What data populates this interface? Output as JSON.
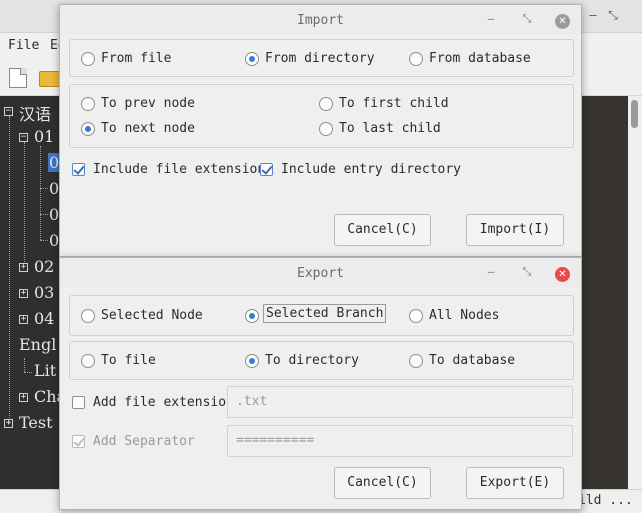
{
  "main": {
    "menu": {
      "file": "File",
      "edit": "Ed"
    },
    "title_buttons": {
      "min": "–",
      "max": "⤡",
      "close": "✕"
    },
    "status": {
      "text": "ild ..."
    },
    "tree": {
      "root1": "汉语",
      "n01": "01",
      "n01_children": [
        "0",
        "0",
        "0",
        "0"
      ],
      "n02": "02",
      "n03": "03",
      "n04": "04",
      "root2": "Engl",
      "lit": "Lit",
      "cha": "Cha",
      "test": "Test",
      "collapse_glyph": "−",
      "expand_glyph": "+"
    }
  },
  "import_dialog": {
    "title": "Import",
    "min": "–",
    "max": "⤡",
    "close": "✕",
    "source": {
      "from_file": "From file",
      "from_directory": "From directory",
      "from_database": "From database",
      "selected": "from_directory"
    },
    "position": {
      "to_prev_node": "To prev node",
      "to_first_child": "To first child",
      "to_next_node": "To next node",
      "to_last_child": "To last child",
      "selected": "to_next_node"
    },
    "include_file_extension": {
      "label": "Include file extension",
      "checked": true
    },
    "include_entry_directory": {
      "label": "Include entry directory",
      "checked": true
    },
    "cancel_label": "Cancel(C)",
    "import_label": "Import(I)"
  },
  "export_dialog": {
    "title": "Export",
    "min": "–",
    "max": "⤡",
    "close": "✕",
    "scope": {
      "selected_node": "Selected Node",
      "selected_branch": "Selected Branch",
      "all_nodes": "All Nodes",
      "selected": "selected_branch"
    },
    "target": {
      "to_file": "To file",
      "to_directory": "To directory",
      "to_database": "To database",
      "selected": "to_directory"
    },
    "add_file_extension": {
      "label": "Add file extension",
      "checked": false,
      "value": ".txt"
    },
    "add_separator": {
      "label": "Add Separator",
      "checked": true,
      "enabled": false,
      "value": "=========="
    },
    "cancel_label": "Cancel(C)",
    "export_label": "Export(E)"
  },
  "colors": {
    "accent": "#3a7bd5",
    "close_active": "#e74c4c",
    "tree_background": "#2f2f2f",
    "tree_selection": "#3f74c4"
  }
}
